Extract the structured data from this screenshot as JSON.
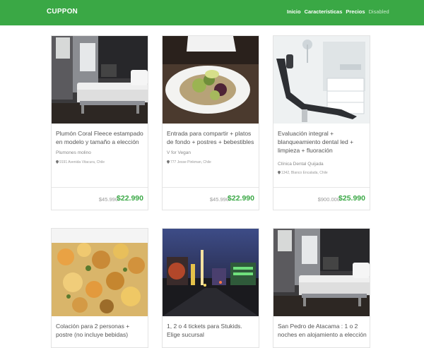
{
  "brand": "CUPPON",
  "nav": {
    "items": [
      "Inicio",
      "Características",
      "Precios",
      "Disabled"
    ]
  },
  "cards": [
    {
      "title": "Plumón Coral Fleece estampado en modelo y tamaño a elección",
      "merchant": "Plumones molino",
      "address": "9191 Avenida Vitacura, Chile",
      "old_price": "$45.990",
      "new_price": "$22.990",
      "image": "bedroom-photo"
    },
    {
      "title": "Entrada para compartir + platos de fondo + postres + bebestibles",
      "merchant": "V for Vegan",
      "address": "777 Jesse Pinkman, Chile",
      "old_price": "$45.990",
      "new_price": "$22.990",
      "image": "salad-photo"
    },
    {
      "title": "Evaluación integral + blanqueamiento dental led + limpieza + fluoración",
      "merchant": "Clínica Dental Quijada",
      "address": "1342, Blanco Encalada, Chile",
      "old_price": "$900.000",
      "new_price": "$25.990",
      "image": "dental-chair-photo"
    },
    {
      "title": "Colación para 2 personas + postre (no incluye bebidas)",
      "image": "food-photo"
    },
    {
      "title": "1, 2 o 4 tickets para Stukids. Elige sucursal",
      "image": "fair-photo"
    },
    {
      "title": "San Pedro de Atacama : 1 o 2 noches en alojamiento a elección",
      "image": "bedroom-photo"
    }
  ],
  "colors": {
    "brand_green": "#3aa845",
    "price_green": "#3aa845"
  }
}
